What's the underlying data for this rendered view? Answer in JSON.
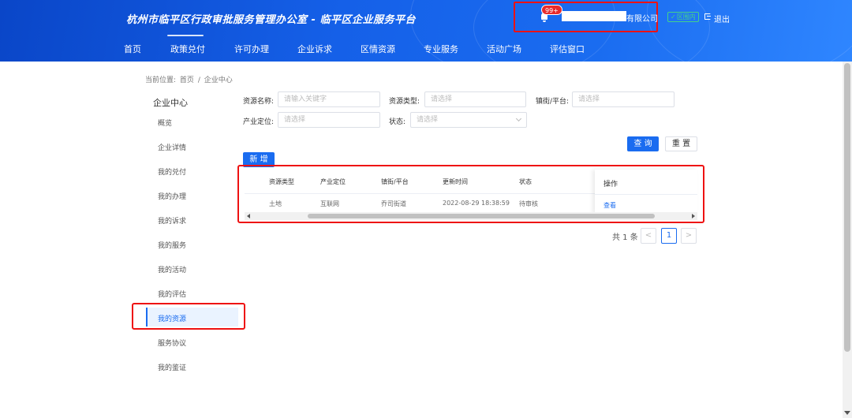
{
  "header": {
    "title": "杭州市临平区行政审批服务管理办公室 - 临平区企业服务平台",
    "nav": [
      "首页",
      "政策兑付",
      "许可办理",
      "企业诉求",
      "区情资源",
      "专业服务",
      "活动广场",
      "评估窗口"
    ],
    "badge": "99+",
    "company_suffix": "有限公司",
    "in_zone": "区围内",
    "logout": "退出",
    "colors": {
      "accent": "#1a6cf0",
      "highlight_box": "#e11111",
      "badge": "#e82b2b"
    }
  },
  "breadcrumb": {
    "prefix": "当前位置:",
    "home": "首页",
    "sep": "/",
    "current": "企业中心"
  },
  "sidebar": {
    "title": "企业中心",
    "items": [
      "概览",
      "企业详情",
      "我的兑付",
      "我的办理",
      "我的诉求",
      "我的服务",
      "我的活动",
      "我的评估",
      "我的资源",
      "服务协议",
      "我的鉴证"
    ],
    "active": "我的资源"
  },
  "filters": {
    "name_label": "资源名称:",
    "name_placeholder": "请输入关键字",
    "type_label": "资源类型:",
    "type_placeholder": "请选择",
    "street_label": "镇街/平台:",
    "street_placeholder": "请选择",
    "industry_label": "产业定位:",
    "industry_placeholder": "请选择",
    "status_label": "状态:",
    "status_placeholder": "请选择"
  },
  "buttons": {
    "query": "查 询",
    "reset": "重 置",
    "add": "新 增"
  },
  "table": {
    "headers": [
      "资源类型",
      "产业定位",
      "镇街/平台",
      "更新时间",
      "状态"
    ],
    "op_header": "操作",
    "rows": [
      {
        "type": "土地",
        "industry": "互联网",
        "street": "乔司街道",
        "updated": "2022-08-29 18:38:59",
        "status": "待审核",
        "action": "查看"
      }
    ]
  },
  "pagination": {
    "total": "共 1 条",
    "current": "1",
    "prev": "<",
    "next": ">"
  }
}
